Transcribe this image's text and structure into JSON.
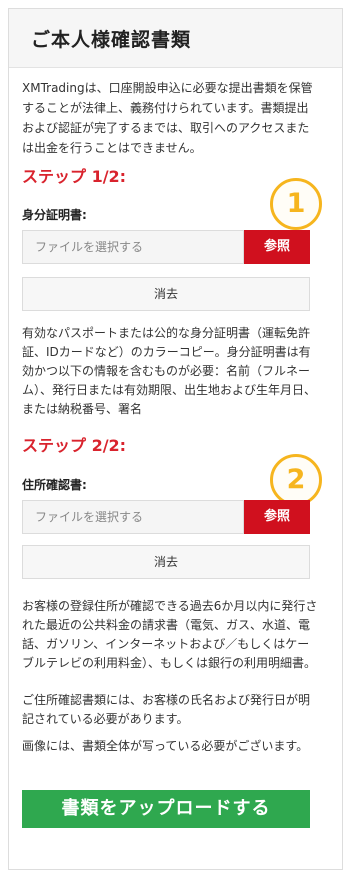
{
  "header": {
    "title": "ご本人様確認書類"
  },
  "intro": "XMTradingは、口座開設申込に必要な提出書類を保管することが法律上、義務付けられています。書類提出および認証が完了するまでは、取引へのアクセスまたは出金を行うことはできません。",
  "step1": {
    "title": "ステップ 1/2:",
    "label": "身分証明書:",
    "placeholder": "ファイルを選択する",
    "browse": "参照",
    "clear": "消去",
    "badge": "1",
    "description": "有効なパスポートまたは公的な身分証明書（運転免許証、IDカードなど）のカラーコピー。身分証明書は有効かつ以下の情報を含むものが必要：名前（フルネーム）、発行日または有効期限、出生地および生年月日、または納税番号、署名"
  },
  "step2": {
    "title": "ステップ 2/2:",
    "label": "住所確認書:",
    "placeholder": "ファイルを選択する",
    "browse": "参照",
    "clear": "消去",
    "badge": "2",
    "description": "お客様の登録住所が確認できる過去6か月以内に発行された最近の公共料金の請求書（電気、ガス、水道、電話、ガソリン、インターネットおよび／もしくはケーブルテレビの利用料金）、もしくは銀行の利用明細書。",
    "note1": "ご住所確認書類には、お客様の氏名および発行日が明記されている必要があります。",
    "note2": "画像には、書類全体が写っている必要がございます。"
  },
  "upload_button": "書類をアップロードする",
  "colors": {
    "accent_red": "#d9232d",
    "browse_red": "#d0101e",
    "upload_green": "#2fa84f",
    "badge_orange": "#f6b51e"
  }
}
